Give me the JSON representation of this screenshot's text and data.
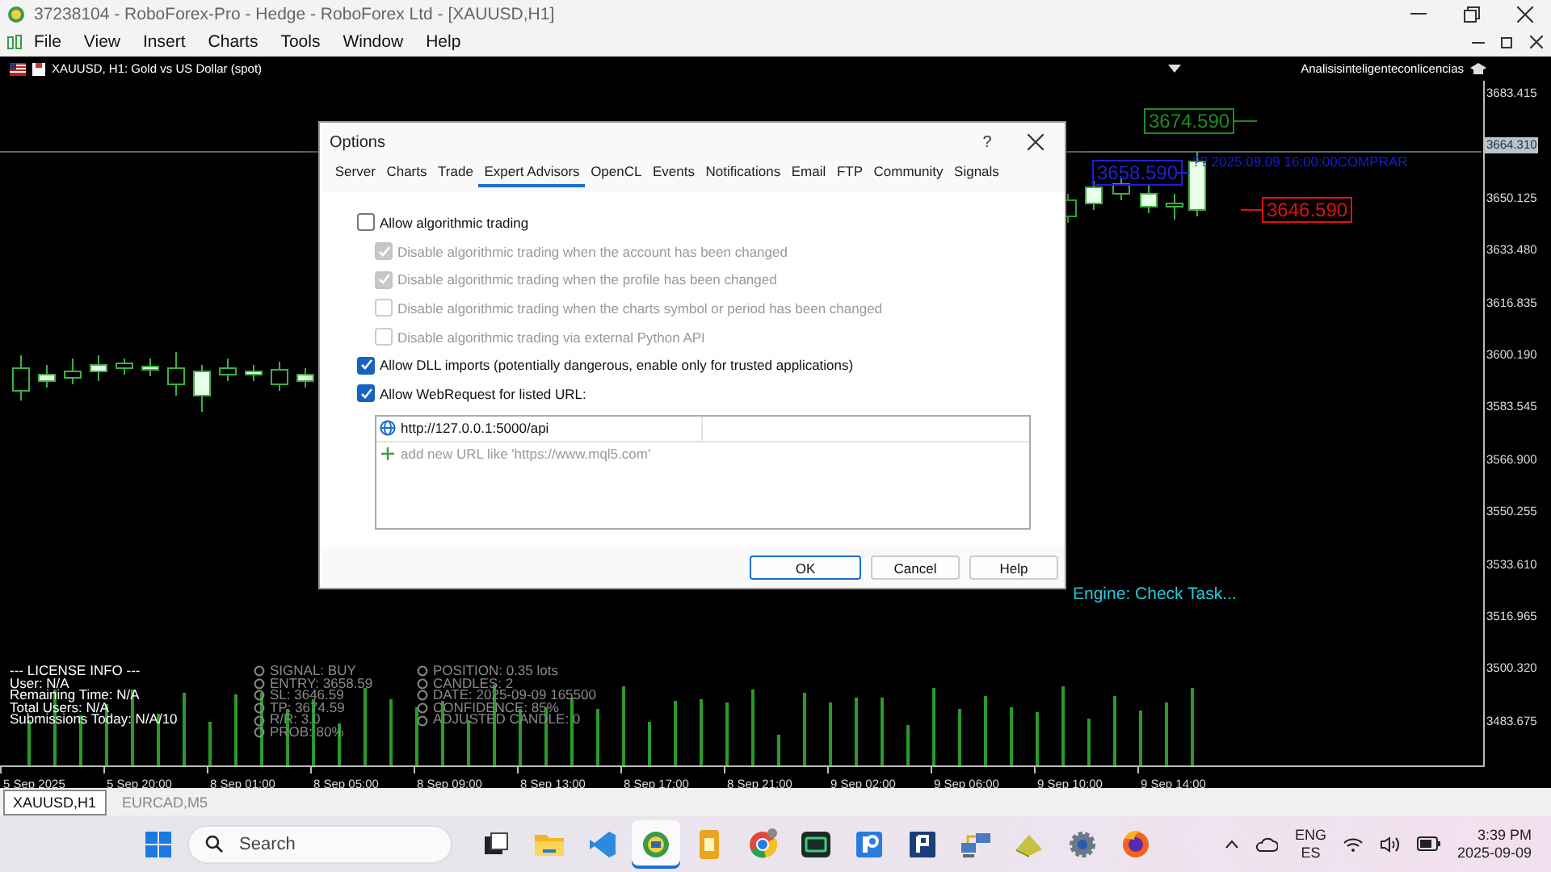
{
  "window": {
    "title": "37238104 - RoboForex-Pro - Hedge - RoboForex Ltd - [XAUUSD,H1]"
  },
  "menu": [
    "File",
    "View",
    "Insert",
    "Charts",
    "Tools",
    "Window",
    "Help"
  ],
  "chart": {
    "symbol_title": "XAUUSD, H1:  Gold vs US Dollar (spot)",
    "indicator_name": "Analisisinteligenteconlicencias",
    "price_axis": [
      "3683.415",
      "3650.125",
      "3633.480",
      "3616.835",
      "3600.190",
      "3583.545",
      "3566.900",
      "3550.255",
      "3533.610",
      "3516.965",
      "3500.320",
      "3483.675"
    ],
    "current_price": "3664.310",
    "time_axis": [
      "5 Sep 2025",
      "5 Sep 20:00",
      "8 Sep 01:00",
      "8 Sep 05:00",
      "8 Sep 09:00",
      "8 Sep 13:00",
      "8 Sep 17:00",
      "8 Sep 21:00",
      "9 Sep 02:00",
      "9 Sep 06:00",
      "9 Sep 10:00",
      "9 Sep 14:00"
    ],
    "price_tags": [
      {
        "kind": "tp",
        "label": "3674.590",
        "color": "#1e8c1e"
      },
      {
        "kind": "entry",
        "label": "3658.590",
        "color": "#2020d0"
      },
      {
        "kind": "sl",
        "label": "3646.590",
        "color": "#e01010"
      }
    ],
    "signal_note": "?? 2025.09.09 16:00:00COMPRAR",
    "engine_status": "Engine: Check Task...",
    "license_info": [
      "--- LICENSE INFO ---",
      "User: N/A",
      "Remaining Time: N/A",
      "Total Users: N/A",
      "Submissions Today: N/A/10"
    ],
    "signal_info": [
      "SIGNAL: BUY",
      "ENTRY: 3658.59",
      "SL: 3646.59",
      "TP: 3674.59",
      "R/R: 3.0",
      "PROB: 80%"
    ],
    "trade_info": [
      "POSITION: 0.35 lots",
      "CANDLES: 2",
      "DATE: 2025-09-09 165500",
      "CONFIDENCE: 85%",
      "ADJUSTED CANDLE: 0"
    ]
  },
  "dialog": {
    "title": "Options",
    "help_label": "?",
    "tabs": [
      {
        "label": "Server",
        "selected": false
      },
      {
        "label": "Charts",
        "selected": false
      },
      {
        "label": "Trade",
        "selected": false
      },
      {
        "label": "Expert Advisors",
        "selected": true
      },
      {
        "label": "OpenCL",
        "selected": false
      },
      {
        "label": "Events",
        "selected": false
      },
      {
        "label": "Notifications",
        "selected": false
      },
      {
        "label": "Email",
        "selected": false
      },
      {
        "label": "FTP",
        "selected": false
      },
      {
        "label": "Community",
        "selected": false
      },
      {
        "label": "Signals",
        "selected": false
      }
    ],
    "options": [
      {
        "label": "Allow algorithmic trading",
        "checked": false,
        "disabled": false,
        "children": [
          {
            "label": "Disable algorithmic trading when the account has been changed",
            "checked": true,
            "disabled": true
          },
          {
            "label": "Disable algorithmic trading when the profile has been changed",
            "checked": true,
            "disabled": true
          },
          {
            "label": "Disable algorithmic trading when the charts symbol or period has been changed",
            "checked": false,
            "disabled": true
          },
          {
            "label": "Disable algorithmic trading via external Python API",
            "checked": false,
            "disabled": true
          }
        ]
      },
      {
        "label": "Allow DLL imports (potentially dangerous, enable only for trusted applications)",
        "checked": true,
        "disabled": false
      },
      {
        "label": "Allow WebRequest for listed URL:",
        "checked": true,
        "disabled": false
      }
    ],
    "url_list": {
      "entries": [
        "http://127.0.0.1:5000/api"
      ],
      "add_hint": "add new URL like 'https://www.mql5.com'"
    },
    "buttons": [
      {
        "label": "OK",
        "default": true
      },
      {
        "label": "Cancel",
        "default": false
      },
      {
        "label": "Help",
        "default": false
      }
    ]
  },
  "chart_tabs": [
    {
      "label": "XAUUSD,H1",
      "selected": true
    },
    {
      "label": "EURCAD,M5",
      "selected": false
    }
  ],
  "taskbar": {
    "search_placeholder": "Search",
    "apps": [
      {
        "kind": "task-view",
        "selected": false
      },
      {
        "kind": "folder",
        "selected": false
      },
      {
        "kind": "code",
        "selected": false
      },
      {
        "kind": "trading",
        "selected": true
      },
      {
        "kind": "document",
        "selected": false
      },
      {
        "kind": "browser",
        "selected": false
      },
      {
        "kind": "terminal",
        "selected": false
      },
      {
        "kind": "blue-app",
        "selected": false
      },
      {
        "kind": "navy-app",
        "selected": false
      },
      {
        "kind": "network",
        "selected": false
      },
      {
        "kind": "book",
        "selected": false
      },
      {
        "kind": "settings",
        "selected": false
      },
      {
        "kind": "fox",
        "selected": false
      }
    ],
    "language": "ENG",
    "layout": "ES",
    "time": "3:39 PM",
    "date": "2025-09-09"
  }
}
